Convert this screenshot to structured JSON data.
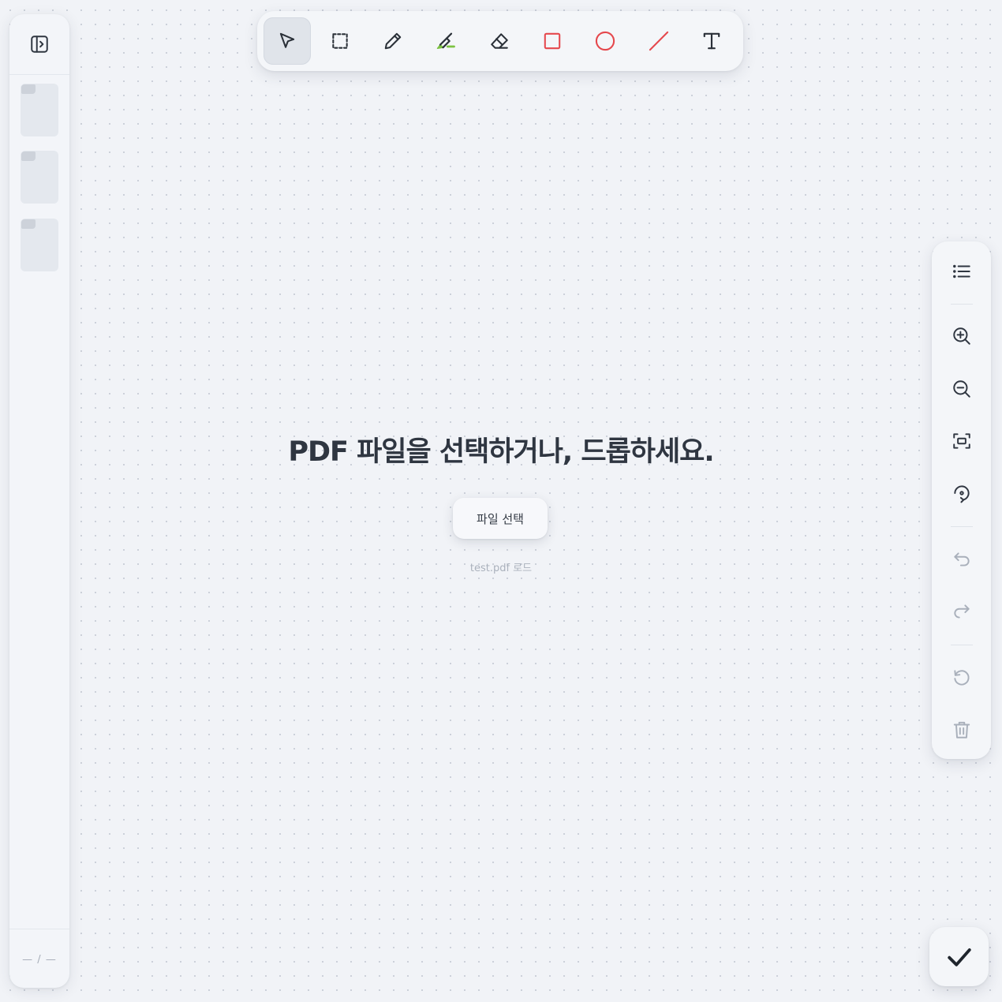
{
  "sidebar": {
    "toggle_icon": "sidebar-toggle-icon",
    "thumbnail_count": 3,
    "page_indicator": "— / —"
  },
  "toolbar": {
    "active_tool": "select",
    "tools": [
      {
        "id": "select",
        "icon": "cursor-arrow-icon"
      },
      {
        "id": "area-select",
        "icon": "dashed-rectangle-icon"
      },
      {
        "id": "pen",
        "icon": "pencil-icon"
      },
      {
        "id": "highlighter",
        "icon": "highlighter-icon",
        "color": "#7cc242"
      },
      {
        "id": "eraser",
        "icon": "eraser-icon"
      },
      {
        "id": "rectangle",
        "icon": "rectangle-icon",
        "color": "#e5484d"
      },
      {
        "id": "ellipse",
        "icon": "circle-icon",
        "color": "#e5484d"
      },
      {
        "id": "line",
        "icon": "line-icon",
        "color": "#e5484d"
      },
      {
        "id": "text",
        "icon": "text-icon"
      }
    ]
  },
  "rightbar": {
    "buttons": [
      {
        "id": "outline",
        "icon": "list-icon"
      },
      {
        "id": "zoom-in",
        "icon": "zoom-in-icon"
      },
      {
        "id": "zoom-out",
        "icon": "zoom-out-icon"
      },
      {
        "id": "fit",
        "icon": "fit-screen-icon"
      },
      {
        "id": "rotate",
        "icon": "rotate-icon"
      },
      {
        "id": "undo",
        "icon": "undo-icon",
        "enabled": false
      },
      {
        "id": "redo",
        "icon": "redo-icon",
        "enabled": false
      },
      {
        "id": "reset",
        "icon": "reset-icon",
        "enabled": false
      },
      {
        "id": "delete",
        "icon": "trash-icon",
        "enabled": false
      }
    ]
  },
  "empty_state": {
    "title": "PDF 파일을 선택하거나, 드롭하세요.",
    "select_button": "파일 선택",
    "load_sample": "test.pdf 로드"
  },
  "confirm": {
    "icon": "check-icon"
  },
  "colors": {
    "background": "#f1f3f7",
    "accent_red": "#e5484d",
    "highlighter_green": "#7cc242",
    "text_dark": "#2f3641",
    "muted": "#aab1bc"
  }
}
